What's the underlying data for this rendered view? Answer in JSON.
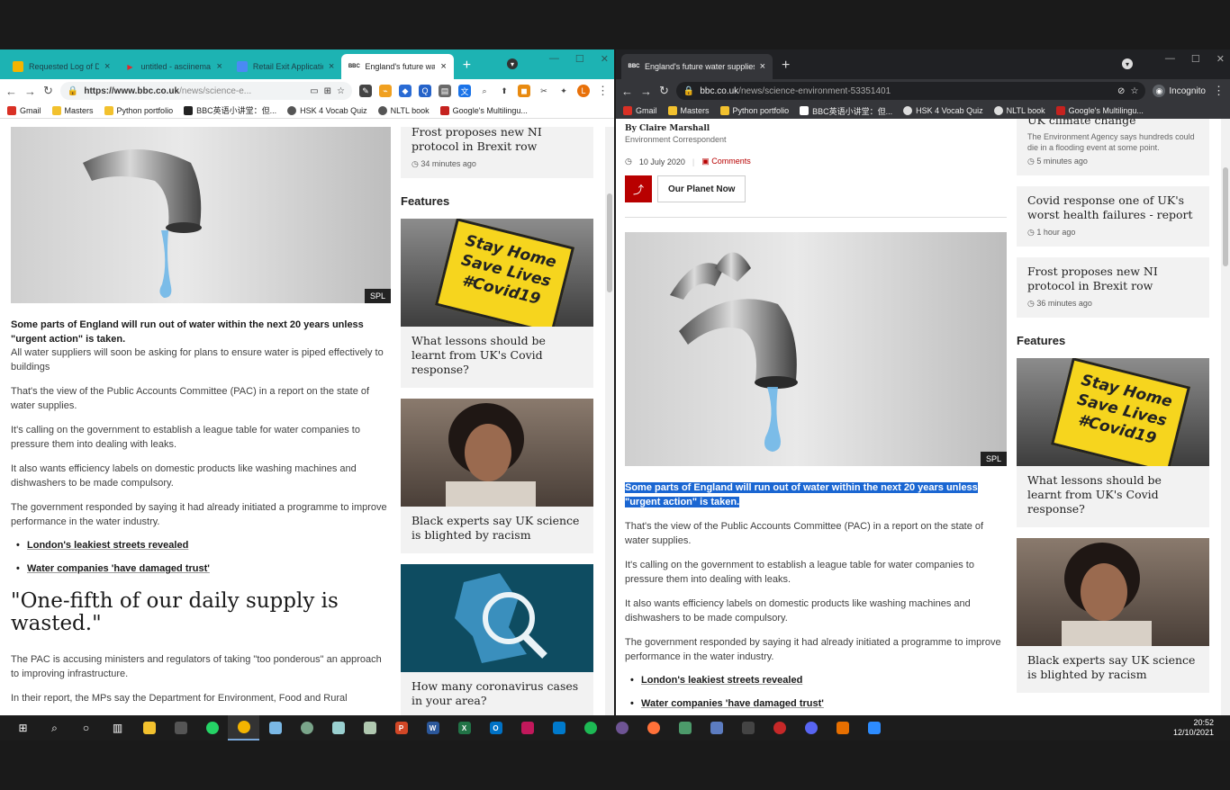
{
  "left": {
    "tabs": [
      {
        "title": "Requested Log of Di",
        "fav_color": "#f4b400"
      },
      {
        "title": "untitled - asciinema",
        "fav_color": "#e3262b"
      },
      {
        "title": "Retail Exit Applicatio",
        "fav_color": "#4a8af4"
      },
      {
        "title": "England's future wa",
        "fav_color": "#222222"
      }
    ],
    "url_host": "https://www.bbc.co.uk",
    "url_path": "/news/science-e...",
    "bookmarks": [
      "Gmail",
      "Masters",
      "Python portfolio",
      "BBC英语小讲堂：但...",
      "HSK 4 Vocab Quiz",
      "NLTL book",
      "Google's Multilingu..."
    ],
    "image_credit": "SPL",
    "lead_bold": "Some parts of England will run out of water within the next 20 years unless \"urgent action\" is taken.",
    "lead_rest": "All water suppliers will soon be asking for plans to ensure water is piped effectively to buildings",
    "paragraphs": [
      "That's the view of the Public Accounts Committee (PAC) in a report on the state of water supplies.",
      "It's calling on the government to establish a league table for water companies to pressure them into dealing with leaks.",
      "It also wants efficiency labels on domestic products like washing machines and dishwashers to be made compulsory.",
      "The government responded by saying it had already initiated a programme to improve performance in the water industry."
    ],
    "links": [
      "London's leakiest streets revealed",
      "Water companies 'have damaged trust'"
    ],
    "quote": "\"One-fifth of our daily supply is wasted.\"",
    "after_quote": [
      "The PAC is accusing ministers and regulators of taking \"too ponderous\" an approach to improving infrastructure.",
      "In their report, the MPs say the Department for Environment, Food and Rural"
    ],
    "side_top": {
      "headline": "Frost proposes new NI protocol in Brexit row",
      "time": "34 minutes ago"
    },
    "features_label": "Features",
    "features": [
      {
        "headline": "What lessons should be learnt from UK's Covid response?"
      },
      {
        "headline": "Black experts say UK science is blighted by racism"
      },
      {
        "headline": "How many coronavirus cases in your area?"
      }
    ],
    "sign_lines": [
      "Stay Home",
      "Save Lives",
      "#Covid19"
    ]
  },
  "right": {
    "tab_title": "England's future water supplies a",
    "url_host": "bbc.co.uk",
    "url_path": "/news/science-environment-53351401",
    "incognito": "Incognito",
    "bookmarks": [
      "Gmail",
      "Masters",
      "Python portfolio",
      "BBC英语小讲堂：但...",
      "HSK 4 Vocab Quiz",
      "NLTL book",
      "Google's Multilingu..."
    ],
    "byline": "By Claire Marshall",
    "role": "Environment Correspondent",
    "date": "10 July 2020",
    "comments": "Comments",
    "topic": "Our Planet Now",
    "image_credit": "SPL",
    "lead_bold": "Some parts of England will run out of water within the next 20 years unless \"urgent action\" is taken.",
    "paragraphs": [
      "That's the view of the Public Accounts Committee (PAC) in a report on the state of water supplies.",
      "It's calling on the government to establish a league table for water companies to pressure them into dealing with leaks.",
      "It also wants efficiency labels on domestic products like washing machines and dishwashers to be made compulsory.",
      "The government responded by saying it had already initiated a programme to improve performance in the water industry."
    ],
    "links": [
      "London's leakiest streets revealed",
      "Water companies 'have damaged trust'"
    ],
    "side_cards": [
      {
        "headline": "UK climate change",
        "sub": "The Environment Agency says hundreds could die in a flooding event at some point.",
        "time": "5 minutes ago"
      },
      {
        "headline": "Covid response one of UK's worst health failures - report",
        "sub": "",
        "time": "1 hour ago"
      },
      {
        "headline": "Frost proposes new NI protocol in Brexit row",
        "sub": "",
        "time": "36 minutes ago"
      }
    ],
    "features_label": "Features",
    "features": [
      {
        "headline": "What lessons should be learnt from UK's Covid response?"
      },
      {
        "headline": "Black experts say UK science is blighted by racism"
      }
    ],
    "sign_lines": [
      "Stay Home",
      "Save Lives",
      "#Covid19"
    ]
  },
  "taskbar": {
    "time": "20:52",
    "date": "12/10/2021"
  }
}
